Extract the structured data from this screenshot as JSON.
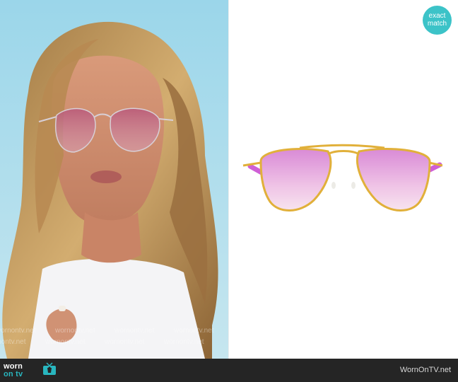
{
  "badge": {
    "line1": "exact",
    "line2": "match"
  },
  "watermark": {
    "text": "wornontv.net"
  },
  "footer": {
    "brand_part1": "worn",
    "brand_part2": "on tv",
    "site": "WornOnTV.net"
  },
  "colors": {
    "accent": "#3cc3c8",
    "footer_bg": "#252525",
    "lens_pink": "#e9a6dd",
    "frame_gold": "#e1b03a",
    "temple_magenta": "#cf5fd6"
  },
  "icons": {
    "tv": "tv-icon",
    "badge": "exact-match-badge"
  }
}
